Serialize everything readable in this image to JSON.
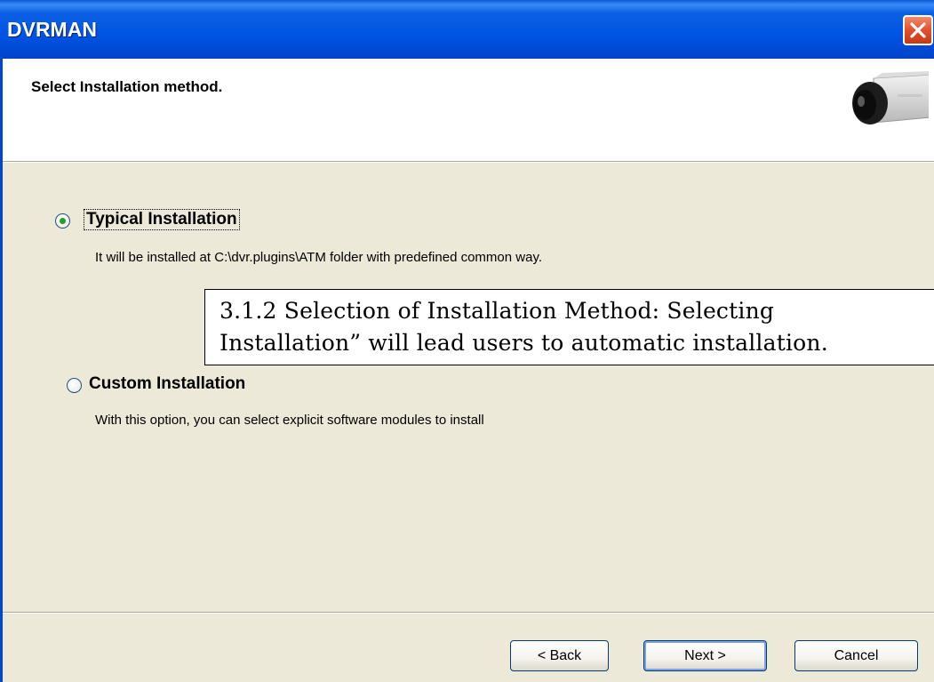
{
  "window": {
    "title": "DVRMAN"
  },
  "header": {
    "title": "Select Installation method.",
    "icon": "camera-icon"
  },
  "options": [
    {
      "label": "Typical Installation",
      "description": "It will be installed at C:\\dvr.plugins\\ATM folder with predefined common way.",
      "selected": true
    },
    {
      "label": "Custom Installation",
      "description": "With this option, you can select explicit software modules to install",
      "selected": false
    }
  ],
  "overlay": {
    "line1": "3.1.2 Selection of Installation Method: Selecting",
    "line2": "Installation” will lead users to automatic installation."
  },
  "buttons": {
    "back": "< Back",
    "next": "Next >",
    "cancel": "Cancel"
  },
  "colors": {
    "titlebar": "#0054e3",
    "close": "#e0502e",
    "dialog_bg": "#ece9d8",
    "radio_dot": "#21a121"
  }
}
